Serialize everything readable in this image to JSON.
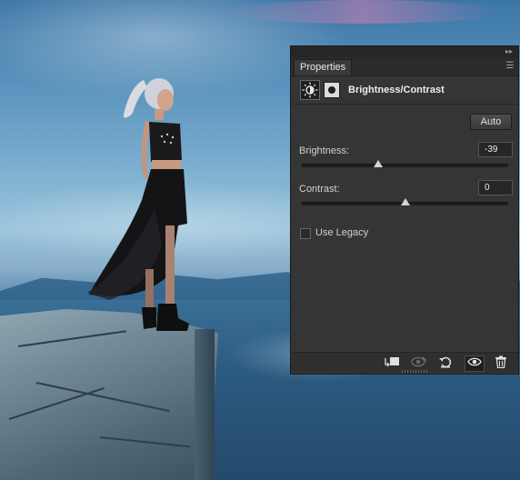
{
  "panel": {
    "tab_label": "Properties",
    "adjustment_title": "Brightness/Contrast",
    "auto_label": "Auto",
    "brightness": {
      "label": "Brightness:",
      "value": "-39",
      "slider_position": 0.37
    },
    "contrast": {
      "label": "Contrast:",
      "value": "0",
      "slider_position": 0.5
    },
    "use_legacy": {
      "label": "Use Legacy",
      "checked": false
    },
    "icons": {
      "collapse": "double-chevron-right-icon",
      "panel_menu": "panel-menu-icon",
      "adjustment": "brightness-contrast-icon",
      "mask": "layer-mask-icon",
      "clip": "clip-to-layer-icon",
      "view_previous": "view-previous-state-icon",
      "reset": "reset-icon",
      "visibility": "eye-icon",
      "delete": "trash-icon"
    }
  },
  "colors": {
    "panel_bg": "#353535",
    "field_bg": "#262626"
  }
}
